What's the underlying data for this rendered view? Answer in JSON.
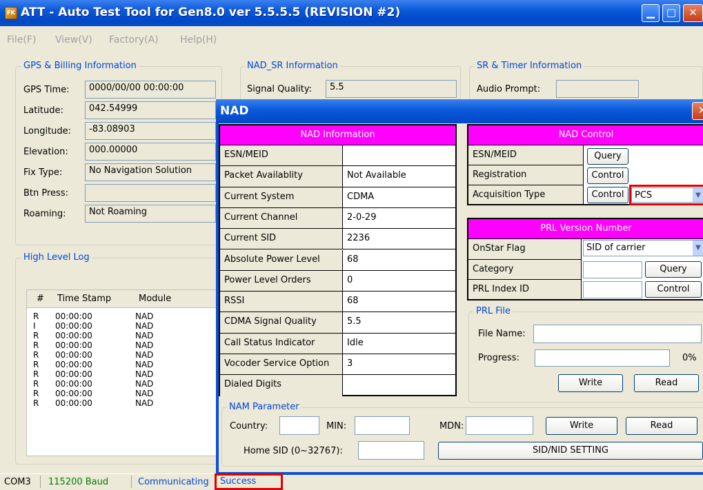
{
  "window": {
    "title": "ATT - Auto Test Tool for Gen8.0 ver 5.5.5.5 (REVISION #2)",
    "icon_text": "FK"
  },
  "menu": [
    "File(F)",
    "View(V)",
    "Factory(A)",
    "Help(H)"
  ],
  "gps": {
    "title": "GPS & Billing Information",
    "rows": [
      {
        "label": "GPS Time:",
        "value": "0000/00/00 00:00:00"
      },
      {
        "label": "Latitude:",
        "value": "042.54999"
      },
      {
        "label": "Longitude:",
        "value": "-83.08903"
      },
      {
        "label": "Elevation:",
        "value": "000.00000"
      },
      {
        "label": "Fix Type:",
        "value": "No Navigation Solution"
      },
      {
        "label": "Btn Press:",
        "value": ""
      },
      {
        "label": "Roaming:",
        "value": "Not Roaming"
      }
    ]
  },
  "nad_sr": {
    "title": "NAD_SR Information",
    "signal_label": "Signal Quality:",
    "signal_value": "5.5"
  },
  "sr_timer": {
    "title": "SR & Timer Information",
    "audio_label": "Audio Prompt:"
  },
  "log": {
    "title": "High Level Log",
    "headers": [
      "#",
      "Time Stamp",
      "Module"
    ],
    "rows": [
      [
        "R",
        "00:00:00",
        "NAD"
      ],
      [
        "I",
        "00:00:00",
        "NAD"
      ],
      [
        "R",
        "00:00:00",
        "NAD"
      ],
      [
        "R",
        "00:00:00",
        "NAD"
      ],
      [
        "R",
        "00:00:00",
        "NAD"
      ],
      [
        "R",
        "00:00:00",
        "NAD"
      ],
      [
        "R",
        "00:00:00",
        "NAD"
      ],
      [
        "R",
        "00:00:00",
        "NAD"
      ],
      [
        "R",
        "00:00:00",
        "NAD"
      ],
      [
        "R",
        "00:00:00",
        "NAD"
      ]
    ]
  },
  "status": {
    "port": "COM3",
    "baud": "115200 Baud",
    "state": "Communicating",
    "message": "Success"
  },
  "dialog": {
    "title": "NAD",
    "close": "✕",
    "info": {
      "title": "NAD Information",
      "rows": [
        {
          "label": "ESN/MEID",
          "value": ""
        },
        {
          "label": "Packet Availablity",
          "value": "Not Available"
        },
        {
          "label": "Current System",
          "value": "CDMA"
        },
        {
          "label": "Current Channel",
          "value": "2-0-29"
        },
        {
          "label": "Current SID",
          "value": "2236"
        },
        {
          "label": "Absolute Power Level",
          "value": "68"
        },
        {
          "label": "Power Level Orders",
          "value": "0"
        },
        {
          "label": "RSSI",
          "value": "68"
        },
        {
          "label": "CDMA Signal Quality",
          "value": "5.5"
        },
        {
          "label": "Call Status Indicator",
          "value": "Idle"
        },
        {
          "label": "Vocoder Service Option",
          "value": "3"
        },
        {
          "label": "Dialed Digits",
          "value": ""
        }
      ]
    },
    "control": {
      "title": "NAD Control",
      "rows": [
        {
          "label": "ESN/MEID",
          "button": "Query"
        },
        {
          "label": "Registration",
          "button": "Control"
        },
        {
          "label": "Acquisition Type",
          "button": "Control",
          "select": "PCS"
        }
      ]
    },
    "prl": {
      "title": "PRL Version Number",
      "rows": [
        {
          "label": "OnStar Flag",
          "select": "SID of carrier"
        },
        {
          "label": "Category",
          "button": "Query"
        },
        {
          "label": "PRL Index ID",
          "button": "Control"
        }
      ]
    },
    "prl_file": {
      "title": "PRL File",
      "file_label": "File Name:",
      "progress_label": "Progress:",
      "progress_value": "0%",
      "progress": 0,
      "write": "Write",
      "read": "Read"
    },
    "nam": {
      "title": "NAM Parameter",
      "country_label": "Country:",
      "min_label": "MIN:",
      "mdn_label": "MDN:",
      "home_sid_label": "Home SID (0~32767):",
      "write": "Write",
      "read": "Read",
      "sid_nid": "SID/NID SETTING"
    }
  },
  "colors": {
    "title_blue": "#0a58d8",
    "header_magenta": "#ff00ff",
    "highlight_red": "#e00000"
  }
}
